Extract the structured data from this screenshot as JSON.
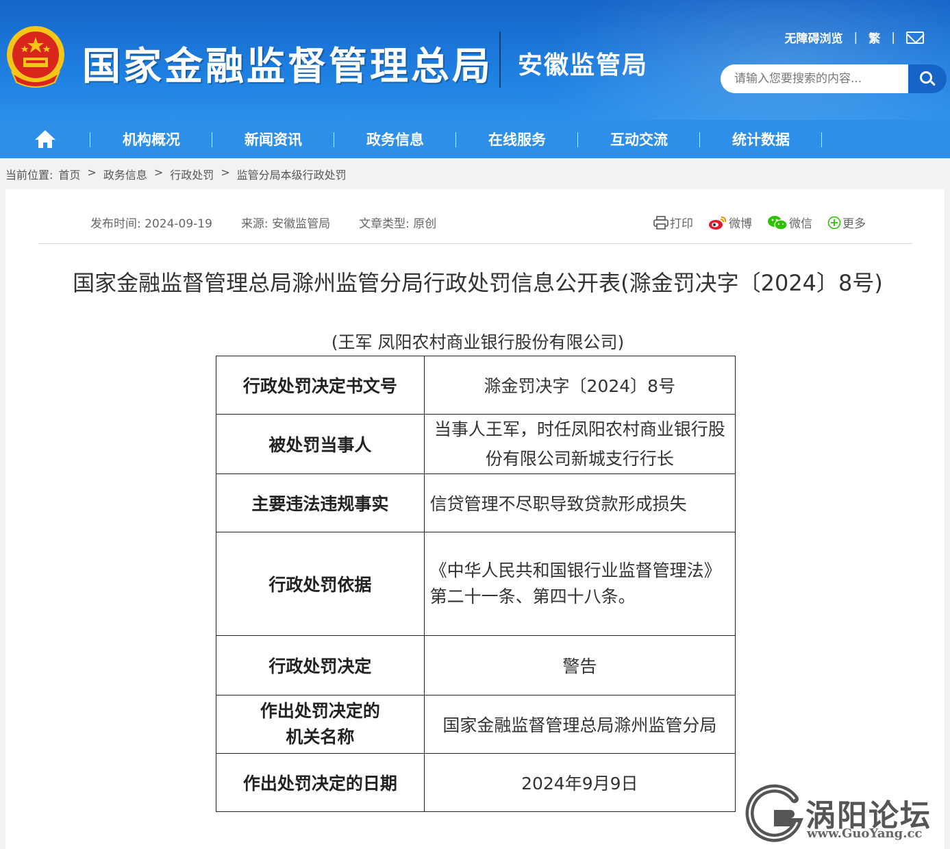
{
  "header": {
    "site_title": "国家金融监督管理总局",
    "sub_title": "安徽监管局",
    "links": {
      "accessible": "无障碍浏览",
      "traditional": "繁"
    },
    "search_placeholder": "请输入您要搜索的内容..."
  },
  "nav": {
    "items": [
      "机构概况",
      "新闻资讯",
      "政务信息",
      "在线服务",
      "互动交流",
      "统计数据"
    ]
  },
  "breadcrumb": {
    "label": "当前位置:",
    "items": [
      "首页",
      "政务信息",
      "行政处罚",
      "监管分局本级行政处罚"
    ],
    "separator": ">"
  },
  "article": {
    "publish": "发布时间: 2024-09-19",
    "source": "来源: 安徽监管局",
    "type": "文章类型: 原创",
    "share": {
      "print": "打印",
      "weibo": "微博",
      "wechat": "微信",
      "more": "更多"
    },
    "title": "国家金融监督管理总局滁州监管分局行政处罚信息公开表(滁金罚决字〔2024〕8号)",
    "subject": "(王军 凤阳农村商业银行股份有限公司)",
    "table": [
      {
        "key": "行政处罚决定书文号",
        "value": "滁金罚决字〔2024〕8号"
      },
      {
        "key": "被处罚当事人",
        "value": "当事人王军，时任凤阳农村商业银行股份有限公司新城支行行长"
      },
      {
        "key": "主要违法违规事实",
        "value": "信贷管理不尽职导致贷款形成损失"
      },
      {
        "key": "行政处罚依据",
        "value": "《中华人民共和国银行业监督管理法》第二十一条、第四十八条。"
      },
      {
        "key": "行政处罚决定",
        "value": "警告"
      },
      {
        "key": "作出处罚决定的机关名称",
        "value": "国家金融监督管理总局滁州监管分局"
      },
      {
        "key": "作出处罚决定的日期",
        "value": "2024年9月9日"
      }
    ]
  },
  "watermark": {
    "name": "涡阳论坛",
    "url": "www.GuoYang.cc"
  },
  "colors": {
    "header_blue": "#1e7fe0",
    "nav_blue": "#2d8fe8",
    "emblem_red": "#d8261c",
    "emblem_gold": "#f5c518"
  }
}
